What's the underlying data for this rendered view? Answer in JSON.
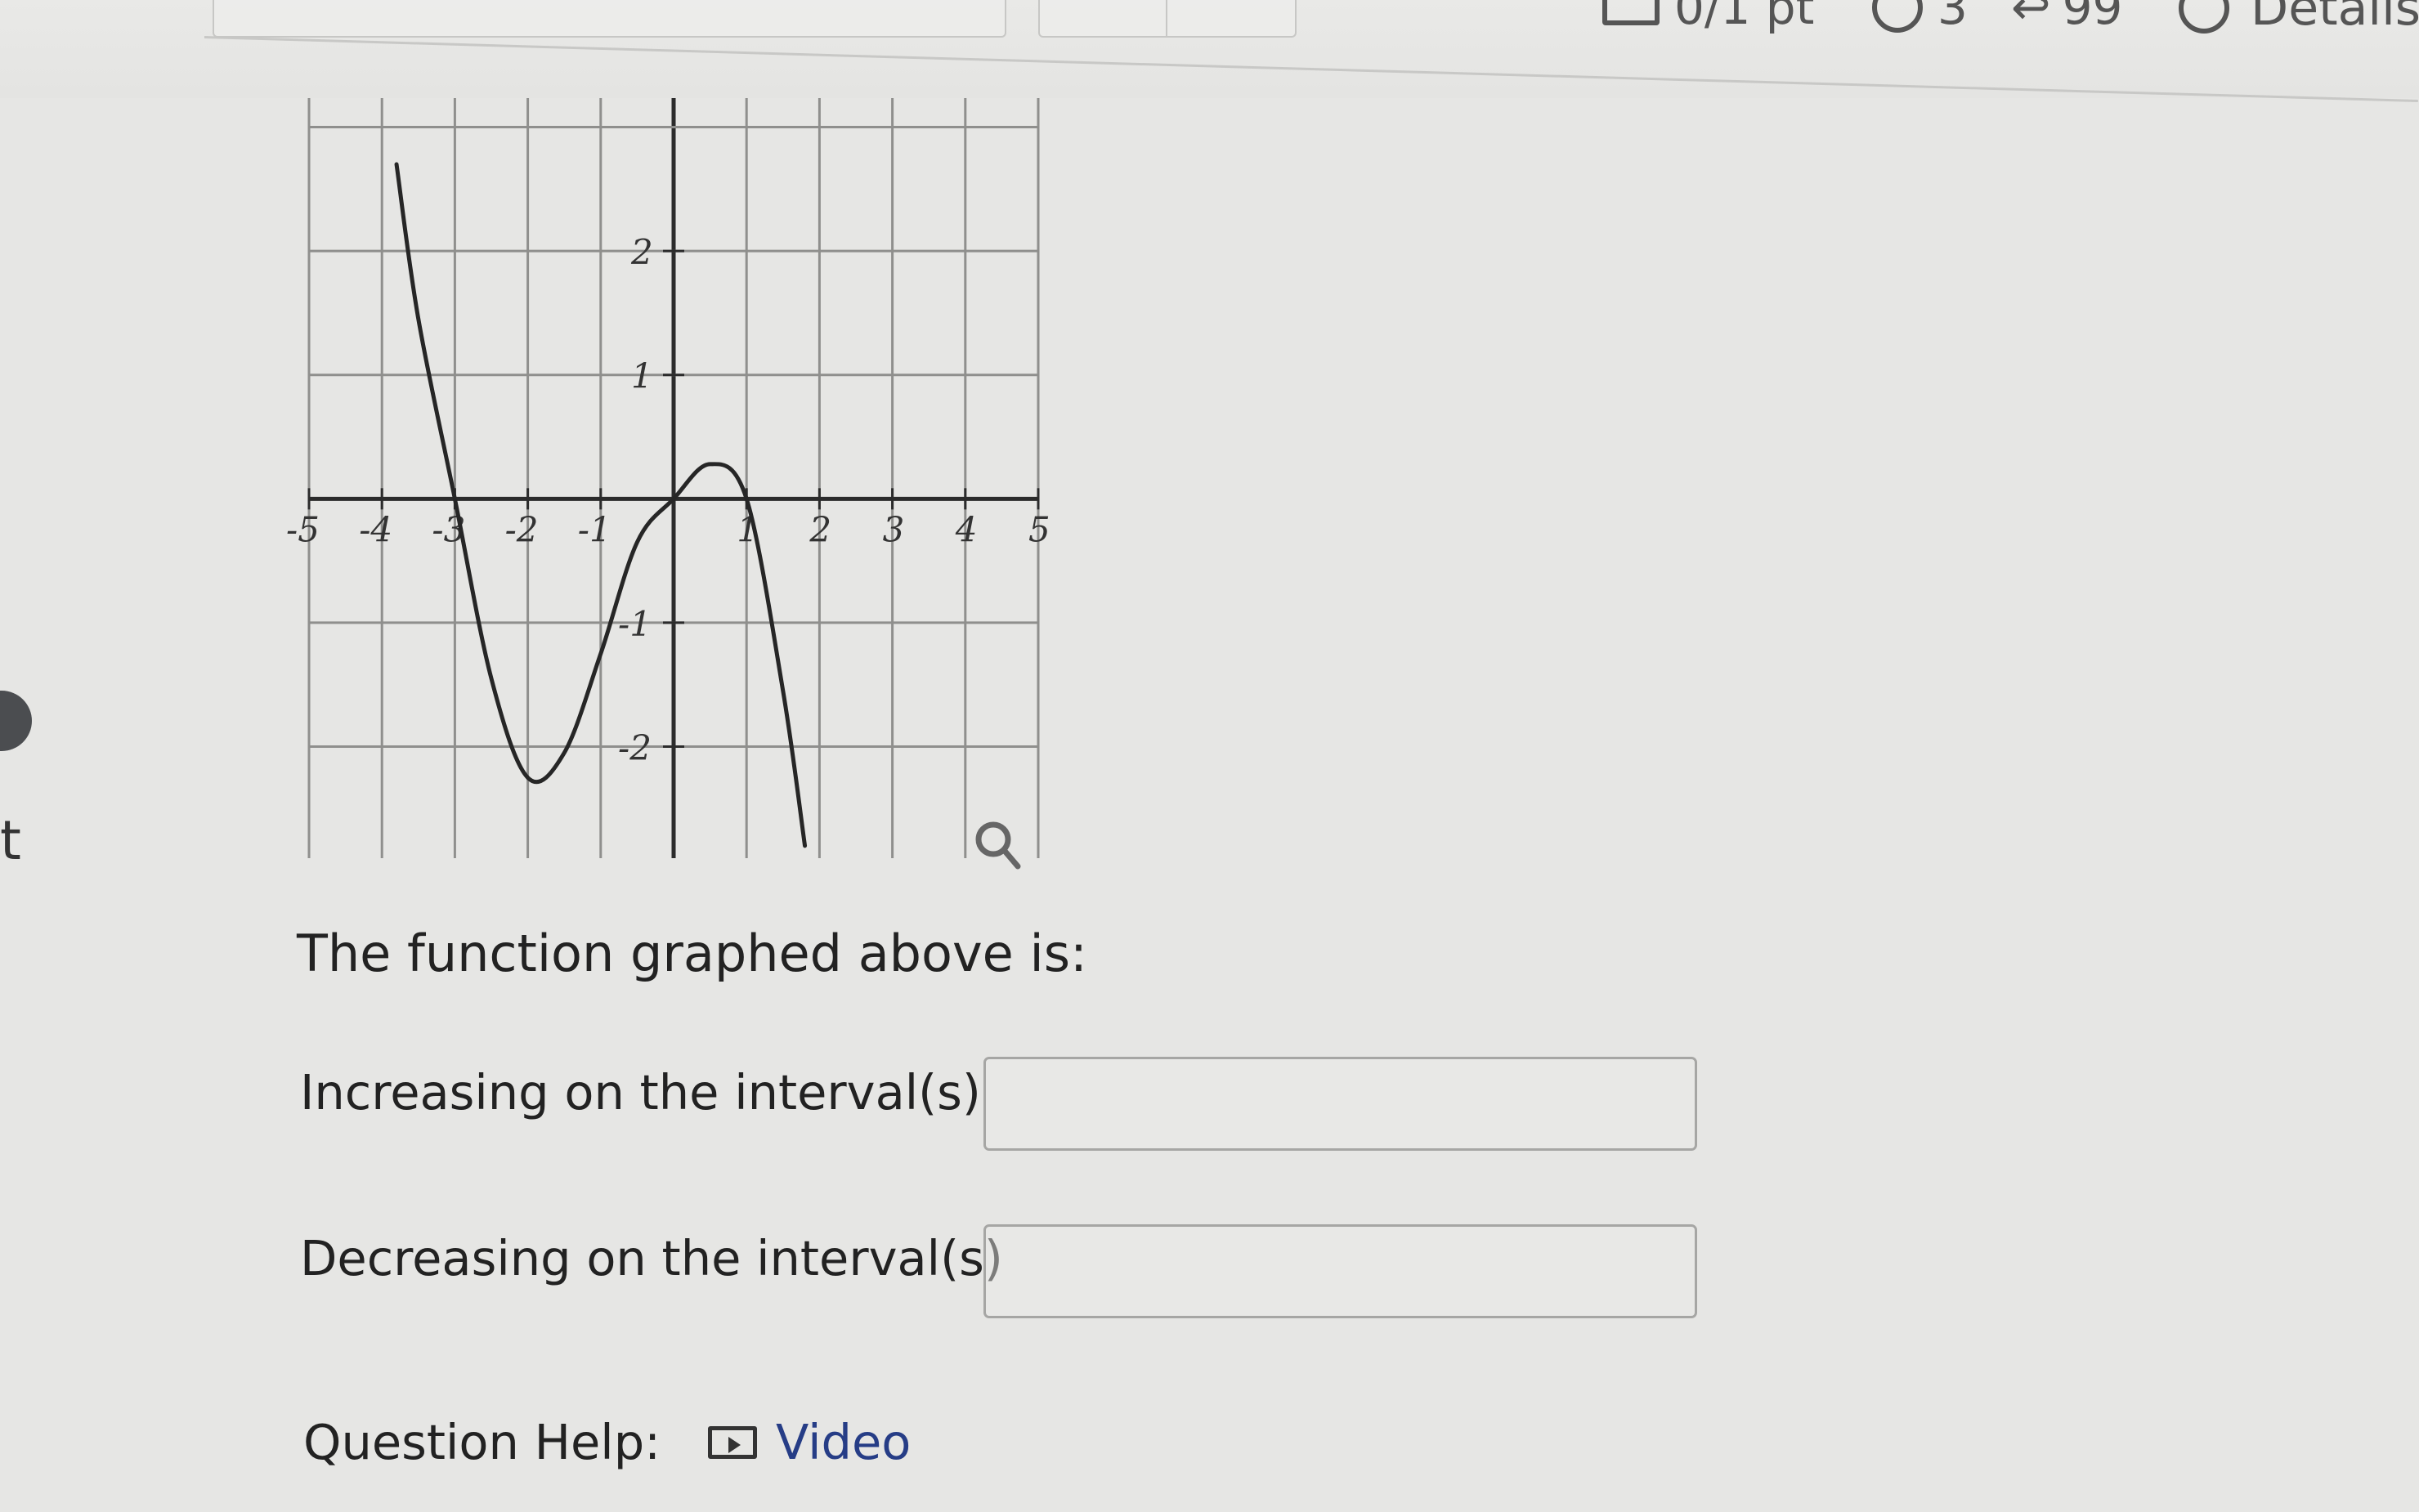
{
  "header": {
    "points_text": "0/1 pt",
    "tries_text": "3",
    "retries_text": "99",
    "details_label": "Details"
  },
  "side": {
    "partial_text": "t"
  },
  "question": {
    "prompt": "The function graphed above is:",
    "increasing_label": "Increasing on the interval(s)",
    "increasing_value": "",
    "decreasing_label": "Decreasing on the interval(s)",
    "decreasing_value": "",
    "help_label": "Question Help:",
    "video_label": "Video"
  },
  "chart_data": {
    "type": "line",
    "x_ticks": [
      "-5",
      "-4",
      "-3",
      "-2",
      "-1",
      "1",
      "2",
      "3",
      "4",
      "5"
    ],
    "y_ticks": [
      "2",
      "1",
      "-1",
      "-2"
    ],
    "xlim": [
      -5,
      5
    ],
    "ylim": [
      -2.9,
      3.3
    ],
    "grid": true,
    "series": [
      {
        "x": [
          -3.8,
          -3.5,
          -3.0,
          -2.5,
          -2.0,
          -1.5,
          -1.0,
          -0.5,
          0.0,
          0.5,
          1.0,
          1.5,
          1.8
        ],
        "y": [
          2.7,
          1.45,
          0.0,
          -1.45,
          -2.25,
          -2.05,
          -1.25,
          -0.35,
          0.0,
          0.28,
          0.0,
          -1.55,
          -2.8
        ]
      }
    ]
  },
  "colors": {
    "background": "#e6e6e4",
    "grid": "#8f8f8d",
    "axis": "#2b2b2b",
    "curve": "#262626",
    "link": "#263d86"
  }
}
